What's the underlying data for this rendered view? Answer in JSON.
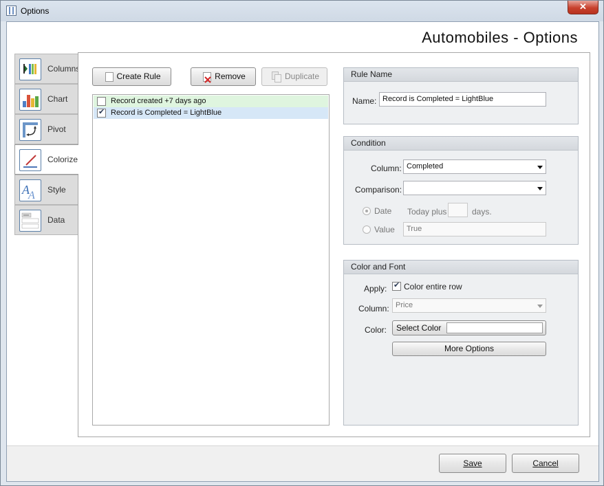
{
  "window": {
    "title": "Options",
    "close_glyph": "✕"
  },
  "header": {
    "title": "Automobiles - Options"
  },
  "tabs": [
    {
      "label": "Columns",
      "icon": "columns-icon"
    },
    {
      "label": "Chart",
      "icon": "chart-icon"
    },
    {
      "label": "Pivot",
      "icon": "pivot-icon"
    },
    {
      "label": "Colorize",
      "icon": "colorize-icon"
    },
    {
      "label": "Style",
      "icon": "style-icon"
    },
    {
      "label": "Data",
      "icon": "data-icon"
    }
  ],
  "toolbar": {
    "create_label": "Create Rule",
    "remove_label": "Remove",
    "duplicate_label": "Duplicate"
  },
  "rules": [
    {
      "label": "Record created +7 days ago",
      "checked": false
    },
    {
      "label": "Record is Completed = LightBlue",
      "checked": true
    }
  ],
  "rule_name": {
    "header": "Rule Name",
    "name_label": "Name:",
    "name_value": "Record is Completed = LightBlue"
  },
  "condition": {
    "header": "Condition",
    "column_label": "Column:",
    "column_value": "Completed",
    "comparison_label": "Comparison:",
    "comparison_value": "",
    "date_label": "Date",
    "today_plus": "Today plus",
    "days": "days.",
    "value_label": "Value",
    "value_value": "True"
  },
  "color_font": {
    "header": "Color and Font",
    "apply_label": "Apply:",
    "color_row_label": "Color entire row",
    "column_label": "Column:",
    "column_value": "Price",
    "color_label": "Color:",
    "select_color": "Select Color",
    "more_options": "More Options"
  },
  "footer": {
    "save": "Save",
    "cancel": "Cancel"
  },
  "colors": {
    "rule1_bg": "#dff5df",
    "rule2_bg": "#d6e7f7",
    "title_bar": "#d5dfea",
    "close": "#c8412d"
  }
}
